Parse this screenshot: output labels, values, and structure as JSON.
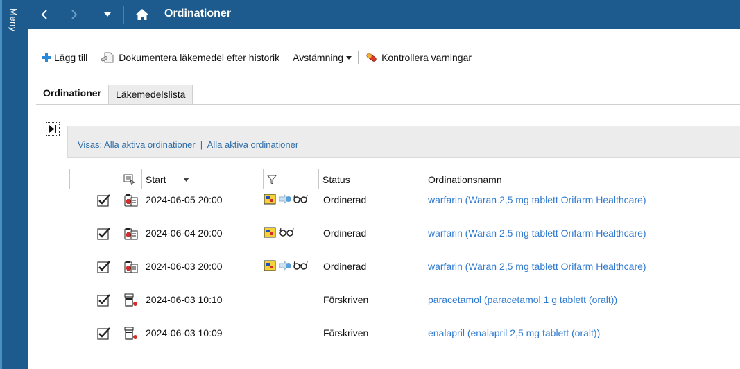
{
  "sidebar": {
    "menu_label": "Meny"
  },
  "header": {
    "title": "Ordinationer"
  },
  "toolbar": {
    "add_label": "Lägg till",
    "document_label": "Dokumentera läkemedel efter historik",
    "reconcile_label": "Avstämning",
    "check_label": "Kontrollera varningar"
  },
  "tabs": [
    {
      "label": "Ordinationer",
      "active": true
    },
    {
      "label": "Läkemedelslista",
      "active": false
    }
  ],
  "filter": {
    "text": "Visas: Alla aktiva ordinationer  |  Alla aktiva ordinationer"
  },
  "table": {
    "columns": {
      "start": "Start",
      "status": "Status",
      "name": "Ordinationsnamn"
    },
    "rows": [
      {
        "start": "2024-06-05 20:00",
        "status": "Ordinerad",
        "name": "warfarin (Waran 2,5 mg tablett Orifarm Healthcare)",
        "type": "warfarin",
        "flags": [
          "sched",
          "ext",
          "glasses"
        ]
      },
      {
        "start": "2024-06-04 20:00",
        "status": "Ordinerad",
        "name": "warfarin (Waran 2,5 mg tablett Orifarm Healthcare)",
        "type": "warfarin",
        "flags": [
          "sched",
          "glasses"
        ]
      },
      {
        "start": "2024-06-03 20:00",
        "status": "Ordinerad",
        "name": "warfarin (Waran 2,5 mg tablett Orifarm Healthcare)",
        "type": "warfarin",
        "flags": [
          "sched",
          "ext",
          "glasses"
        ]
      },
      {
        "start": "2024-06-03 10:10",
        "status": "Förskriven",
        "name": "paracetamol (paracetamol 1 g tablett (oralt))",
        "type": "prescription",
        "flags": []
      },
      {
        "start": "2024-06-03 10:09",
        "status": "Förskriven",
        "name": "enalapril (enalapril 2,5 mg tablett (oralt))",
        "type": "prescription",
        "flags": []
      }
    ]
  },
  "colors": {
    "header_bg": "#1d5b8f",
    "link": "#2f7ad0",
    "accent_blue": "#2a8ad8"
  }
}
